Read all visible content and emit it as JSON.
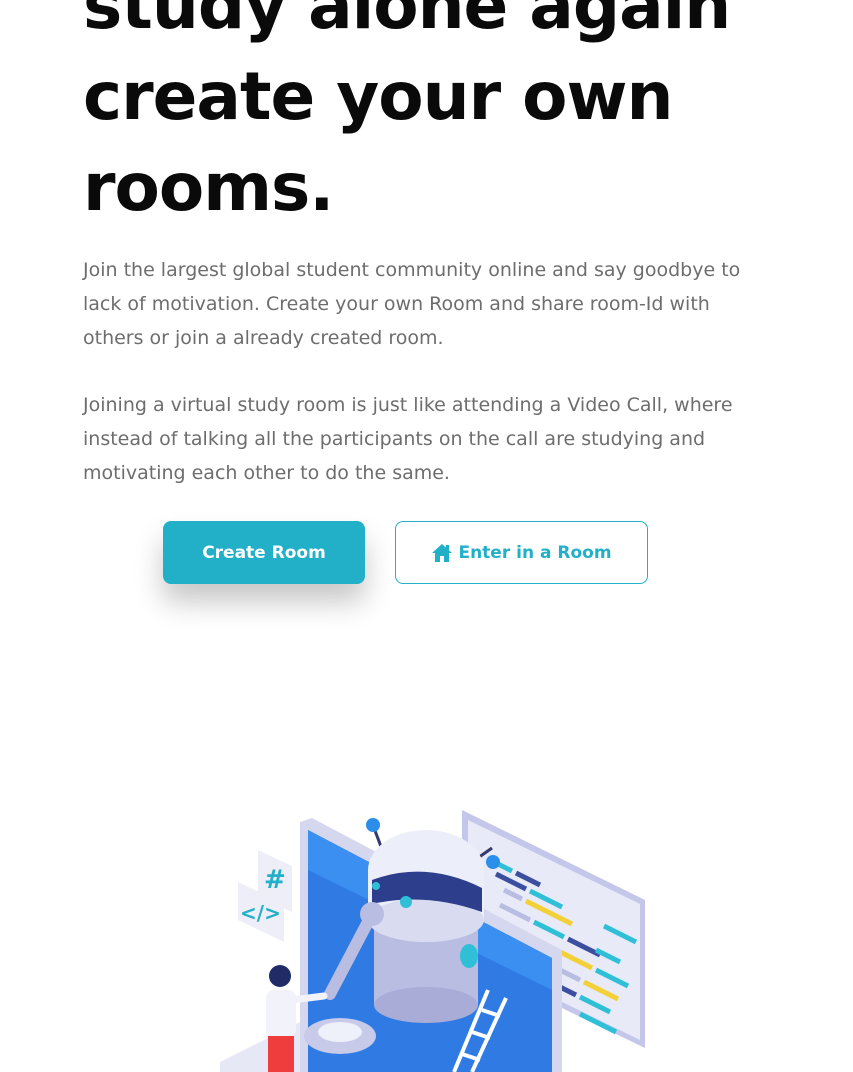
{
  "hero": {
    "headline_lines": [
      "study alone again",
      "create your own",
      "rooms."
    ],
    "paragraph1_lines": [
      "Join the largest global student community online and say goodbye to",
      "lack of motivation. Create your own Room and share room-Id with",
      "others or join a already created room."
    ],
    "paragraph2_lines": [
      "Joining a virtual study room is just like attending a Video Call, where",
      "instead of talking all the participants on the call are studying and",
      "motivating each other to do the same."
    ],
    "create_button_label": "Create Room",
    "enter_button_label": "Enter in a Room",
    "enter_button_icon": "home-icon"
  },
  "illustration": {
    "hash_symbol": "#",
    "code_symbol": "</>"
  },
  "colors": {
    "accent": "#22b0c8",
    "headline": "#0a0a0a",
    "body_text": "#6d6d6d"
  }
}
